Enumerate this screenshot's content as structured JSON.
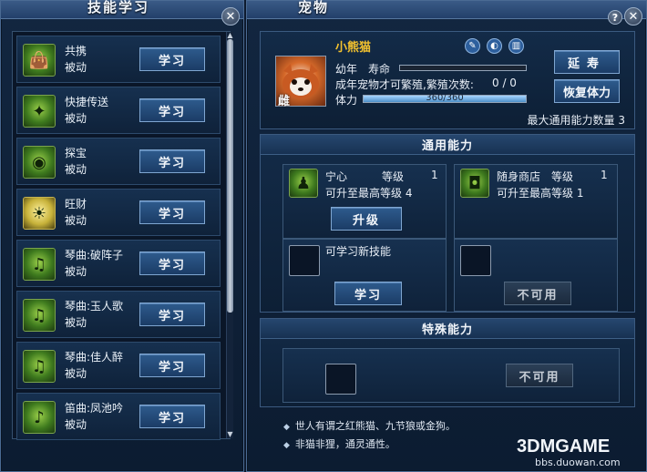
{
  "skills_panel": {
    "title": "技能学习",
    "close_label": "✕",
    "skills": [
      {
        "name": "共携",
        "type": "被动",
        "button": "学习",
        "icon": "bag-icon",
        "glyph": "👜"
      },
      {
        "name": "快捷传送",
        "type": "被动",
        "button": "学习",
        "icon": "teleport-icon",
        "glyph": "✦"
      },
      {
        "name": "探宝",
        "type": "被动",
        "button": "学习",
        "icon": "eye-icon",
        "glyph": "◉"
      },
      {
        "name": "旺财",
        "type": "被动",
        "button": "学习",
        "icon": "sun-moon-icon",
        "glyph": "☀"
      },
      {
        "name": "琴曲:破阵子",
        "type": "被动",
        "button": "学习",
        "icon": "zither-icon",
        "glyph": "♫"
      },
      {
        "name": "琴曲:玉人歌",
        "type": "被动",
        "button": "学习",
        "icon": "zither-icon",
        "glyph": "♫"
      },
      {
        "name": "琴曲:佳人醉",
        "type": "被动",
        "button": "学习",
        "icon": "zither-icon",
        "glyph": "♫"
      },
      {
        "name": "笛曲:凤池吟",
        "type": "被动",
        "button": "学习",
        "icon": "flute-icon",
        "glyph": "♪"
      }
    ]
  },
  "pet_panel": {
    "title": "宠物",
    "help_label": "?",
    "close_label": "✕",
    "pet": {
      "name": "小熊猫",
      "gender": "雌",
      "stage_label": "幼年",
      "lifespan_label": "寿命",
      "breed_text": "成年宠物才可繁殖,繁殖次数:",
      "breed_count": "0 / 0",
      "stamina_label": "体力",
      "stamina_text": "360/360",
      "stamina_fraction": 1.0,
      "lifespan_fraction": 0.0,
      "extend_button": "延寿",
      "restore_button": "恢复体力",
      "max_abilities_text": "最大通用能力数量 3"
    },
    "general": {
      "header": "通用能力",
      "abilities": [
        {
          "name": "宁心",
          "level_label": "等级",
          "level": "1",
          "max_text": "可升至最高等级 4",
          "icon": "meditation-icon",
          "glyph": "♟"
        },
        {
          "name": "随身商店",
          "level_label": "等级",
          "level": "1",
          "max_text": "可升至最高等级 1",
          "icon": "shop-icon",
          "glyph": "◘"
        }
      ],
      "upgrade_button": "升级",
      "learn_new_text": "可学习新技能",
      "learn_button": "学习",
      "unavailable_button": "不可用"
    },
    "special": {
      "header": "特殊能力",
      "unavailable_button": "不可用"
    },
    "notes": [
      "世人有谓之红熊猫、九节狼或金狗。",
      "非猫非狸，通灵通性。"
    ]
  },
  "watermark": {
    "site": "bbs.duowan.com",
    "brand": "3DMGAME"
  }
}
